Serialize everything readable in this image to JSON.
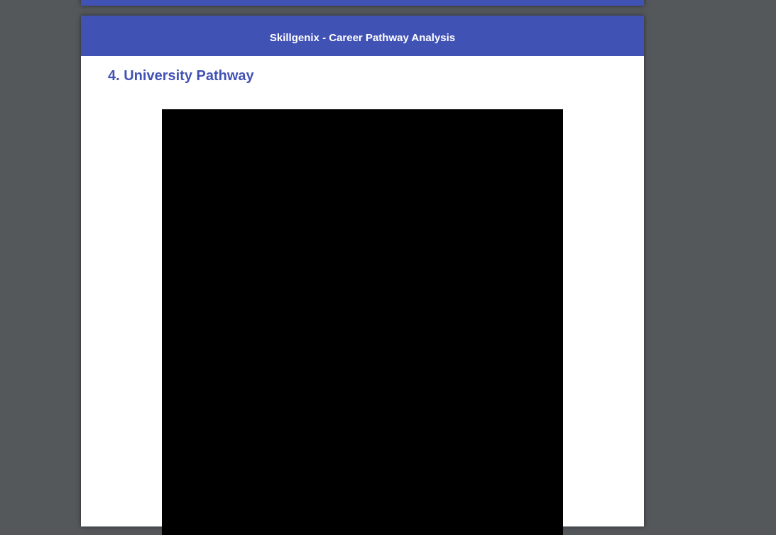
{
  "header": {
    "title": "Skillgenix - Career Pathway Analysis"
  },
  "section": {
    "heading": "4. University Pathway"
  },
  "colors": {
    "brand": "#4152b5",
    "background": "#54585b"
  }
}
